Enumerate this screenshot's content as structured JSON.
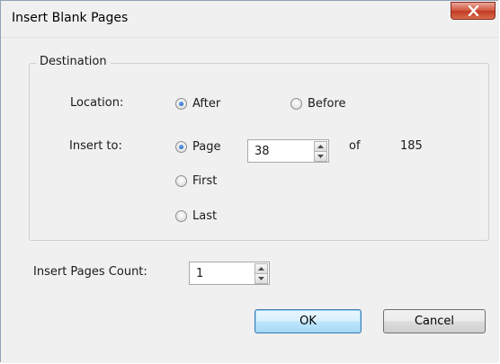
{
  "window": {
    "title": "Insert Blank Pages"
  },
  "destination": {
    "group_title": "Destination",
    "location_label": "Location:",
    "location_options": {
      "after": "After",
      "before": "Before"
    },
    "location_selected": "After",
    "insert_to_label": "Insert to:",
    "insert_to_options": {
      "page": "Page",
      "first": "First",
      "last": "Last"
    },
    "insert_to_selected": "Page",
    "page_value": "38",
    "of_label": "of",
    "total_pages": "185"
  },
  "count": {
    "label": "Insert Pages Count:",
    "value": "1"
  },
  "buttons": {
    "ok": "OK",
    "cancel": "Cancel"
  }
}
